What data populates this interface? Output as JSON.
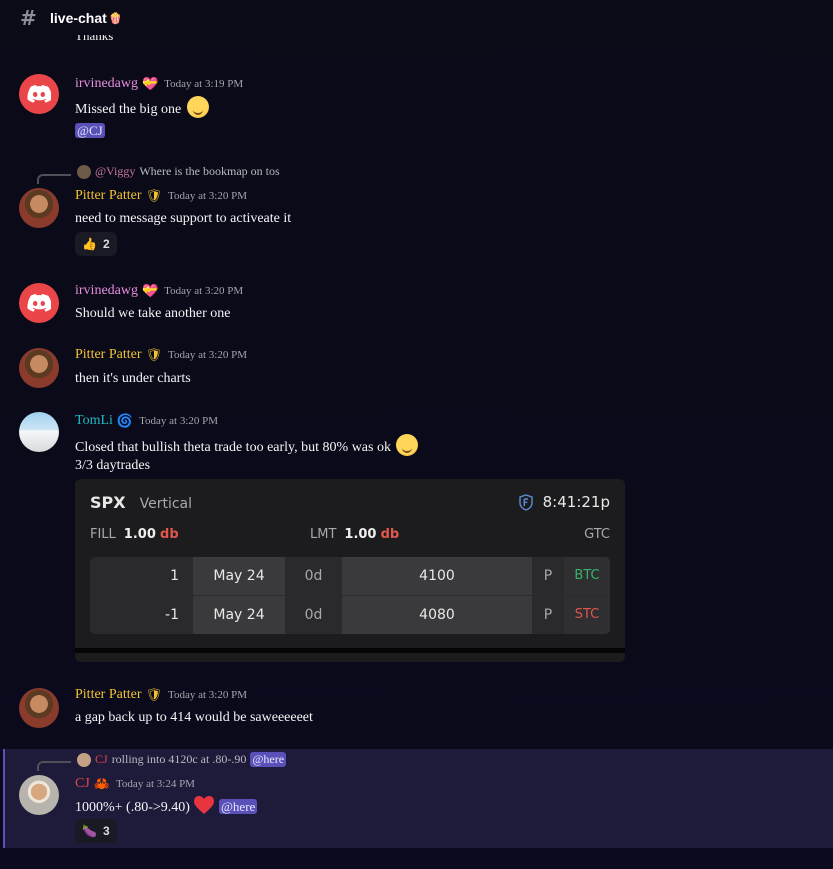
{
  "channel": {
    "name": "live-chat",
    "emoji": "🍿"
  },
  "cutoff_text": "Thanks",
  "messages": [
    {
      "author": "irvinedawg",
      "badge": "💝",
      "time": "Today at 3:19 PM",
      "text": "Missed the big one",
      "mention": "@CJ"
    },
    {
      "reply_mention": "@Viggy",
      "reply_text": "Where is the bookmap on tos",
      "author": "Pitter Patter",
      "badge": "🛡",
      "time": "Today at 3:20 PM",
      "text": "need to message support to activeate it",
      "reaction": {
        "emoji": "👍",
        "count": "2"
      }
    },
    {
      "author": "irvinedawg",
      "badge": "💝",
      "time": "Today at 3:20 PM",
      "text": "Should we take another one"
    },
    {
      "author": "Pitter Patter",
      "badge": "🛡",
      "time": "Today at 3:20 PM",
      "text": "then it's under charts"
    },
    {
      "author": "TomLi",
      "badge": "🌀",
      "time": "Today at 3:20 PM",
      "text": "Closed that bullish theta trade too early, but 80% was ok",
      "text2": "3/3 daytrades"
    },
    {
      "author": "Pitter Patter",
      "badge": "🛡",
      "time": "Today at 3:20 PM",
      "text": "a gap back up to 414 would be saweeeeeet"
    },
    {
      "reply_mention": "CJ",
      "reply_text": "rolling into 4120c at .80-.90",
      "reply_tag": "@here",
      "author": "CJ",
      "badge": "🦀",
      "time": "Today at 3:24 PM",
      "text": "1000%+ (.80->9.40)",
      "mention": "@here",
      "reaction": {
        "emoji": "🍆",
        "count": "3"
      }
    }
  ],
  "trade_card": {
    "symbol": "SPX",
    "strategy": "Vertical",
    "time": "8:41:21p",
    "fill_label": "FILL",
    "fill_value": "1.00",
    "fill_unit": "db",
    "lmt_label": "LMT",
    "lmt_value": "1.00",
    "lmt_unit": "db",
    "tif": "GTC",
    "legs": [
      {
        "qty": "1",
        "expiry": "May 24",
        "dte": "0d",
        "strike": "4100",
        "type": "P",
        "action": "BTC"
      },
      {
        "qty": "-1",
        "expiry": "May 24",
        "dte": "0d",
        "strike": "4080",
        "type": "P",
        "action": "STC"
      }
    ]
  },
  "colors": {
    "irvinedawg": "#e78ee1",
    "pitter": "#f1c232",
    "tomli": "#1fbcc6",
    "cj": "#e8434c",
    "btc": "#37b36b",
    "stc": "#e2574c",
    "mention_bg": "#5a51b8"
  }
}
